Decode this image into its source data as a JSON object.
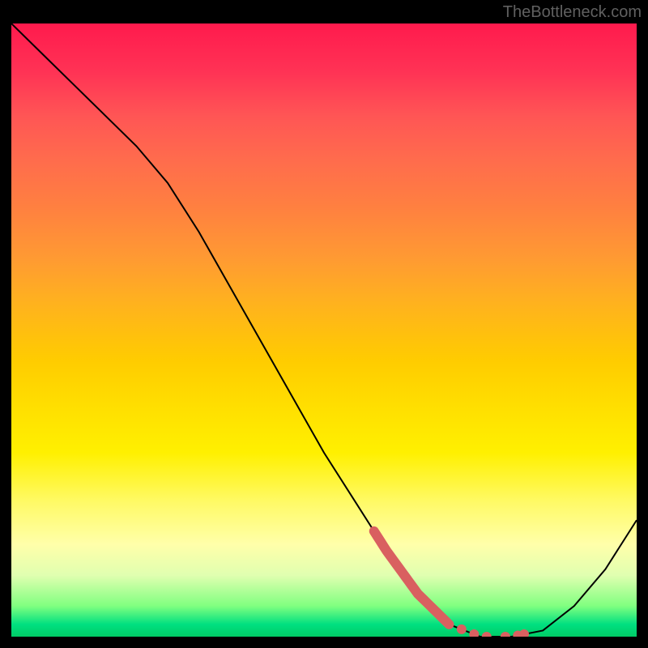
{
  "watermark": "TheBottleneck.com",
  "chart_data": {
    "type": "line",
    "title": "",
    "xlabel": "",
    "ylabel": "",
    "xlim": [
      0,
      100
    ],
    "ylim": [
      0,
      100
    ],
    "series": [
      {
        "name": "curve",
        "x": [
          0,
          5,
          10,
          15,
          20,
          25,
          30,
          35,
          40,
          45,
          50,
          55,
          60,
          65,
          70,
          75,
          80,
          85,
          90,
          95,
          100
        ],
        "values": [
          100,
          95,
          90,
          85,
          80,
          74,
          66,
          57,
          48,
          39,
          30,
          22,
          14,
          7,
          2,
          0,
          0,
          1,
          5,
          11,
          19
        ]
      }
    ],
    "annotations": {
      "red_dot_cluster": {
        "description": "cluster of red dots/line segment on lower right portion of curve",
        "x_range": [
          58,
          82
        ],
        "y_range": [
          0,
          21
        ],
        "color": "#d96060"
      }
    },
    "gradient_background": {
      "description": "vertical gradient from red to green",
      "colors": [
        "#ff1a4d",
        "#ff9933",
        "#ffe000",
        "#00cc66"
      ]
    }
  }
}
